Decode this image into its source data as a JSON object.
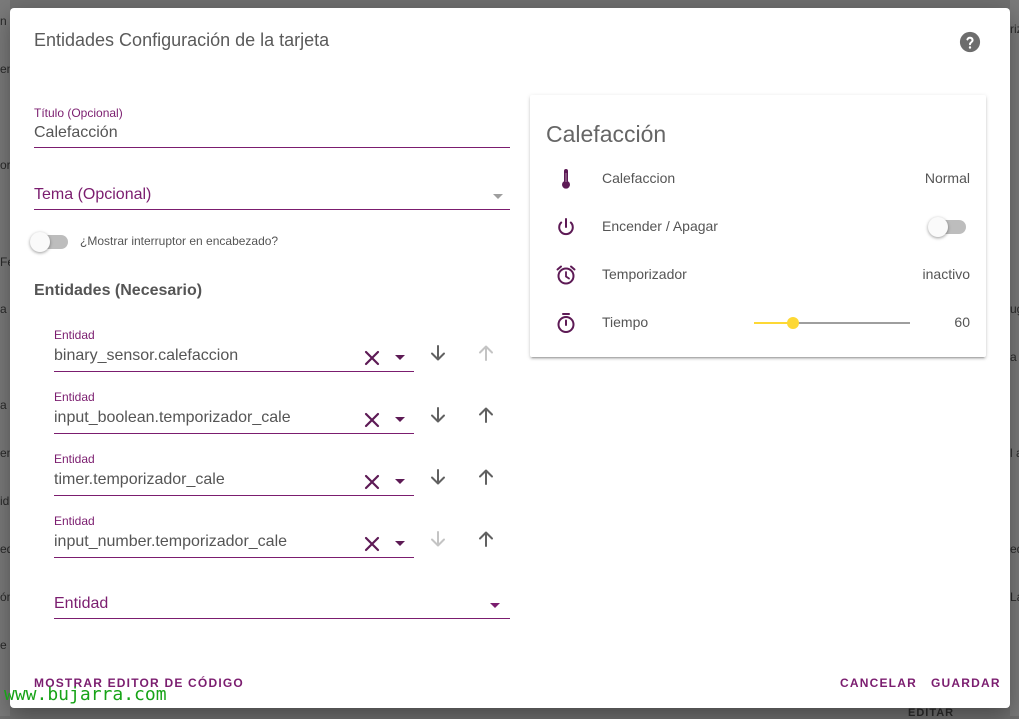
{
  "dialog": {
    "title": "Entidades Configuración de la tarjeta"
  },
  "form": {
    "title_field": {
      "label": "Título (Opcional)",
      "value": "Calefacción"
    },
    "theme_field": {
      "label": "Tema (Opcional)"
    },
    "header_toggle_label": "¿Mostrar interruptor en encabezado?",
    "entities_heading": "Entidades (Necesario)",
    "entities": [
      {
        "label": "Entidad",
        "value": "binary_sensor.calefaccion"
      },
      {
        "label": "Entidad",
        "value": "input_boolean.temporizador_cale"
      },
      {
        "label": "Entidad",
        "value": "timer.temporizador_cale"
      },
      {
        "label": "Entidad",
        "value": "input_number.temporizador_cale"
      }
    ],
    "new_entity_label": "Entidad"
  },
  "preview": {
    "title": "Calefacción",
    "rows": [
      {
        "icon": "thermometer-icon",
        "name": "Calefaccion",
        "state": "Normal"
      },
      {
        "icon": "power-icon",
        "name": "Encender / Apagar",
        "state": ""
      },
      {
        "icon": "alarm-clock-icon",
        "name": "Temporizador",
        "state": "inactivo"
      },
      {
        "icon": "timer-icon",
        "name": "Tiempo",
        "state": "60"
      }
    ],
    "slider_fraction": 0.25
  },
  "footer": {
    "code_editor": "MOSTRAR EDITOR DE CÓDIGO",
    "cancel": "CANCELAR",
    "save": "GUARDAR"
  },
  "watermark": "www.bujarra.com",
  "background": {
    "fragments": [
      "n",
      "en",
      "or",
      "Fe",
      "a",
      "a",
      "en",
      "id",
      "ed",
      "ón",
      "e U",
      "riz",
      "ug",
      "a",
      "l a",
      "ed",
      "La",
      "EDITAR"
    ]
  },
  "colors": {
    "accent": "#7b1d6f",
    "slider": "#fdd835",
    "icon": "#5d1a55"
  }
}
